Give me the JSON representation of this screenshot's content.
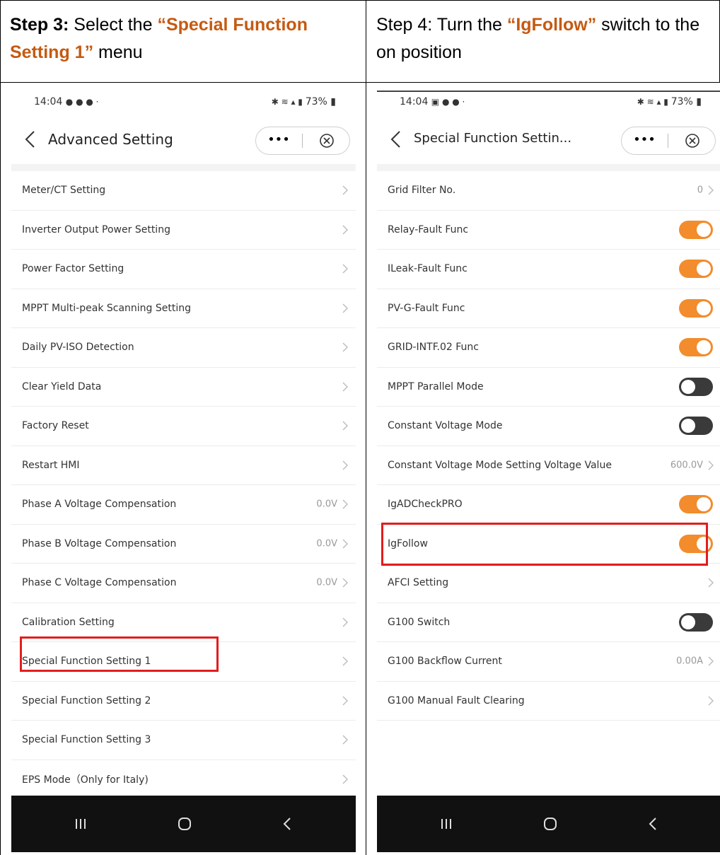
{
  "captions": {
    "left": {
      "prefix": "Step 3:",
      "mid": " Select the ",
      "highlight": "“Special Function Setting 1”",
      "suffix": " menu"
    },
    "right": {
      "prefix": "Step 4: Turn the ",
      "highlight": "“IgFollow”",
      "suffix": " switch to the on position"
    }
  },
  "colors": {
    "highlight_text": "#c55a11",
    "toggle_on": "#f28c2c",
    "toggle_off": "#3a3a3a",
    "box": "#e21d1d"
  },
  "left_phone": {
    "status_time": "14:04 ",
    "status_right": "73%",
    "title": "Advanced Setting",
    "menu_dots": "•••",
    "items": [
      {
        "label": "Meter/CT Setting",
        "value": ""
      },
      {
        "label": "Inverter Output Power Setting",
        "value": ""
      },
      {
        "label": "Power Factor Setting",
        "value": ""
      },
      {
        "label": "MPPT Multi-peak Scanning Setting",
        "value": ""
      },
      {
        "label": "Daily PV-ISO Detection",
        "value": ""
      },
      {
        "label": "Clear Yield Data",
        "value": ""
      },
      {
        "label": "Factory Reset",
        "value": ""
      },
      {
        "label": "Restart HMI",
        "value": ""
      },
      {
        "label": "Phase A Voltage Compensation",
        "value": "0.0V"
      },
      {
        "label": "Phase B Voltage Compensation",
        "value": "0.0V"
      },
      {
        "label": "Phase C Voltage Compensation",
        "value": "0.0V"
      },
      {
        "label": "Calibration Setting",
        "value": ""
      },
      {
        "label": "Special Function Setting 1",
        "value": ""
      },
      {
        "label": "Special Function Setting 2",
        "value": ""
      },
      {
        "label": "Special Function Setting 3",
        "value": ""
      },
      {
        "label": "EPS Mode（Only for Italy)",
        "value": ""
      }
    ]
  },
  "right_phone": {
    "status_time": "14:04 ",
    "status_right": "73%",
    "title": "Special Function Settin...",
    "menu_dots": "•••",
    "items": [
      {
        "label": "Grid Filter No.",
        "value": "0",
        "type": "value"
      },
      {
        "label": "Relay-Fault Func",
        "type": "toggle",
        "on": true
      },
      {
        "label": "ILeak-Fault Func",
        "type": "toggle",
        "on": true
      },
      {
        "label": "PV-G-Fault Func",
        "type": "toggle",
        "on": true
      },
      {
        "label": "GRID-INTF.02 Func",
        "type": "toggle",
        "on": true
      },
      {
        "label": "MPPT Parallel Mode",
        "type": "toggle",
        "on": false
      },
      {
        "label": "Constant Voltage Mode",
        "type": "toggle",
        "on": false
      },
      {
        "label": "Constant Voltage Mode Setting Voltage Value",
        "value": "600.0V",
        "type": "value"
      },
      {
        "label": "IgADCheckPRO",
        "type": "toggle",
        "on": true
      },
      {
        "label": "IgFollow",
        "type": "toggle",
        "on": true
      },
      {
        "label": "AFCI Setting",
        "value": "",
        "type": "value"
      },
      {
        "label": "G100 Switch",
        "type": "toggle",
        "on": false
      },
      {
        "label": "G100 Backflow Current",
        "value": "0.00A",
        "type": "value"
      },
      {
        "label": "G100 Manual Fault Clearing",
        "value": "",
        "type": "value"
      }
    ]
  }
}
